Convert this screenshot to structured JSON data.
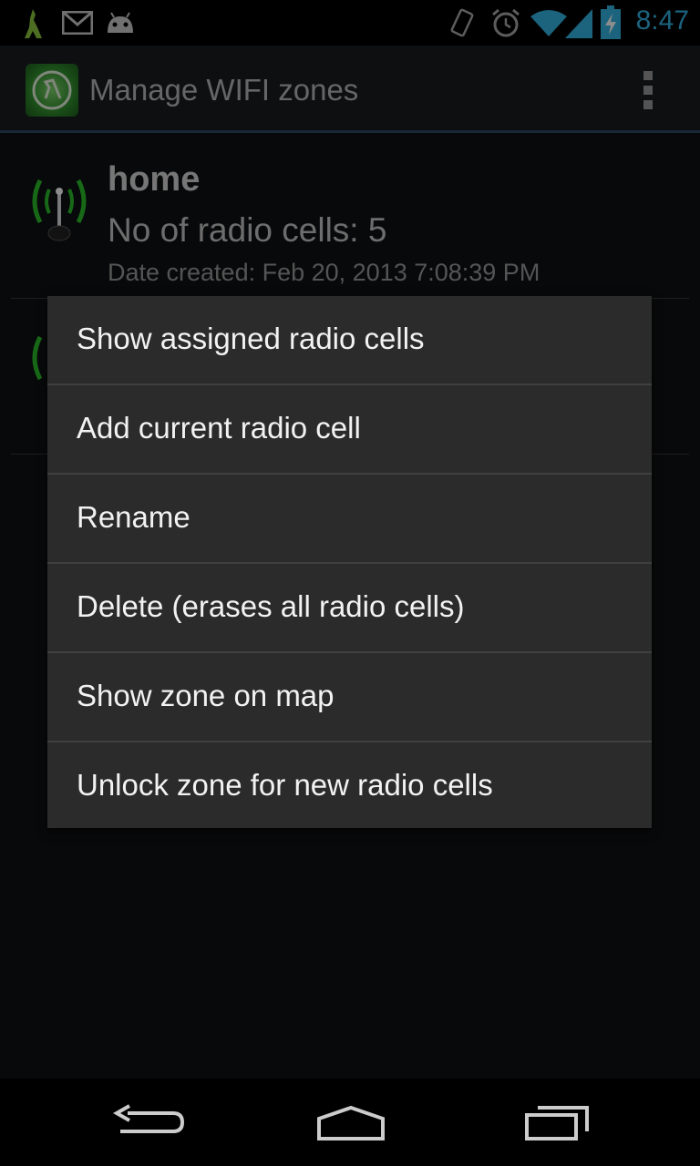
{
  "status_bar": {
    "time": "8:47",
    "icons": [
      "kangaroo-icon",
      "gmail-icon",
      "android-icon",
      "vibrate-icon",
      "alarm-icon",
      "wifi-icon",
      "signal-icon",
      "battery-charging-icon"
    ],
    "time_color": "#33b5e5"
  },
  "action_bar": {
    "title": "Manage WIFI zones",
    "app_icon": "wifi-zone-app-icon",
    "overflow_icon": "overflow-menu-icon"
  },
  "zones": [
    {
      "name": "home",
      "cells": "No of radio cells: 5",
      "date": "Date created: Feb 20, 2013 7:08:39 PM",
      "icon": "radio-antenna-icon"
    },
    {
      "name": "",
      "cells": "",
      "date": "",
      "icon": "radio-antenna-icon"
    }
  ],
  "context_menu": {
    "items": [
      {
        "label": "Show assigned radio cells"
      },
      {
        "label": "Add current radio cell"
      },
      {
        "label": "Rename"
      },
      {
        "label": "Delete (erases all radio cells)"
      },
      {
        "label": "Show zone on map"
      },
      {
        "label": "Unlock zone for new radio cells"
      }
    ]
  },
  "nav_bar": {
    "back_icon": "back-icon",
    "home_icon": "home-icon",
    "recents_icon": "recent-apps-icon"
  }
}
